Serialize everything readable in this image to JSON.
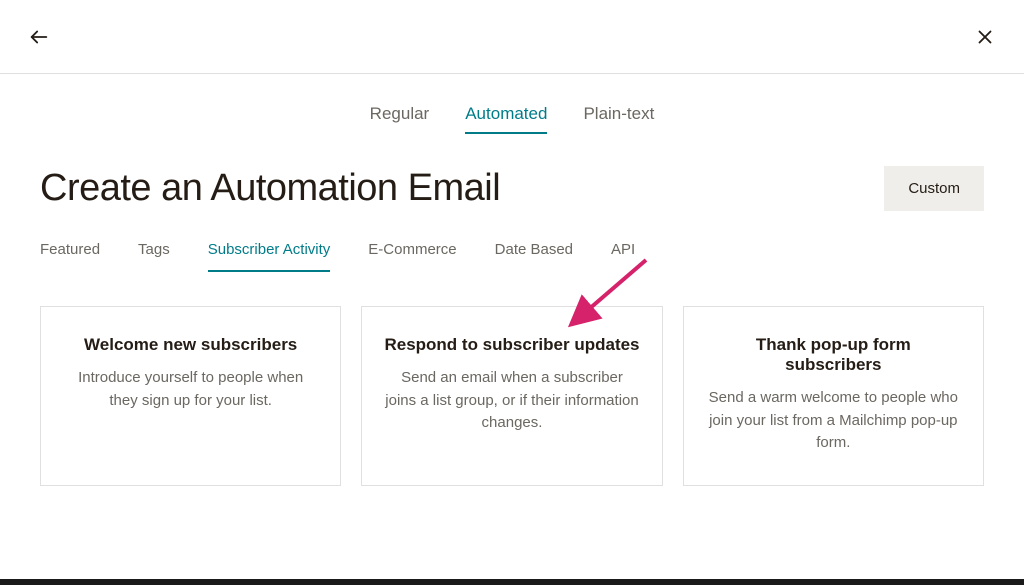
{
  "topTabs": {
    "regular": "Regular",
    "automated": "Automated",
    "plainText": "Plain-text"
  },
  "pageTitle": "Create an Automation Email",
  "customButton": "Custom",
  "subTabs": {
    "featured": "Featured",
    "tags": "Tags",
    "subscriberActivity": "Subscriber Activity",
    "ecommerce": "E-Commerce",
    "dateBased": "Date Based",
    "api": "API"
  },
  "cards": [
    {
      "title": "Welcome new subscribers",
      "desc": "Introduce yourself to people when they sign up for your list."
    },
    {
      "title": "Respond to subscriber updates",
      "desc": "Send an email when a subscriber joins a list group, or if their information changes."
    },
    {
      "title": "Thank pop-up form subscribers",
      "desc": "Send a warm welcome to people who join your list from a Mailchimp pop-up form."
    }
  ]
}
